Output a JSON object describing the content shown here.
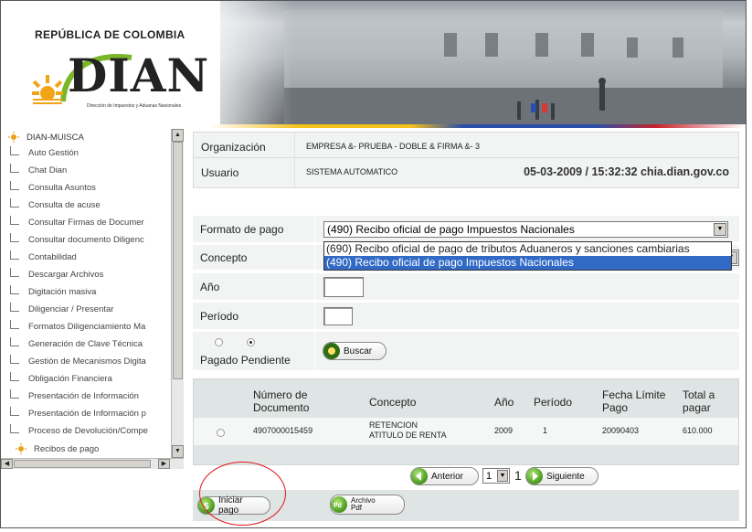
{
  "header": {
    "country": "REPÚBLICA DE COLOMBIA",
    "logo_text": "DIAN",
    "logo_subtitle": "Dirección de Impuestos y Aduanas Nacionales"
  },
  "sidebar": {
    "root": "DIAN-MUISCA",
    "items": [
      "Auto Gestión",
      "Chat Dian",
      "Consulta Asuntos",
      "Consulta de acuse",
      "Consultar Firmas de Documer",
      "Consultar documento Diligenc",
      "Contabilidad",
      "Descargar Archivos",
      "Digitación masiva",
      "Diligenciar / Presentar",
      "Formatos Diligenciamiento Ma",
      "Generación de Clave Técnica",
      "Gestión de Mecanismos Digita",
      "Obligación Financiera",
      "Presentación de Información",
      "Presentación de Información p",
      "Proceso de Devolución/Compe"
    ],
    "last_folder": "Recibos de pago"
  },
  "info": {
    "organizacion_label": "Organización",
    "organizacion_value": "EMPRESA &- PRUEBA - DOBLE & FIRMA &- 3",
    "usuario_label": "Usuario",
    "usuario_value": "SISTEMA AUTOMATICO",
    "datetime": "05-03-2009 / 15:32:32 chia.dian.gov.co"
  },
  "form": {
    "formato_label": "Formato de pago",
    "formato_value": "(490) Recibo oficial de pago Impuestos Nacionales",
    "formato_options": [
      "(690) Recibo oficial de pago de tributos Aduaneros y sanciones cambiarias",
      "(490) Recibo oficial de pago Impuestos Nacionales"
    ],
    "concepto_label": "Concepto",
    "anio_label": "Año",
    "periodo_label": "Período",
    "status_label": "Pagado Pendiente",
    "buscar_label": "Buscar"
  },
  "results": {
    "headers": [
      "Número de Documento",
      "Concepto",
      "Año",
      "Período",
      "Fecha Límite Pago",
      "Total a pagar"
    ],
    "rows": [
      {
        "numero": "4907000015459",
        "concepto": "RETENCION ATITULO DE RENTA",
        "anio": "2009",
        "periodo": "1",
        "fecha": "20090403",
        "total": "610.000"
      }
    ]
  },
  "pager": {
    "prev_label": "Anterior",
    "page_value": "1",
    "total_pages": "1",
    "next_label": "Siguiente"
  },
  "actions": {
    "iniciar_label": "Iniciar pago",
    "archivo_label": "Archivo Pdf"
  },
  "colors": {
    "highlight": "#316ac5",
    "annotation_circle": "#e0141b",
    "row_background": "#f2f4f4"
  }
}
